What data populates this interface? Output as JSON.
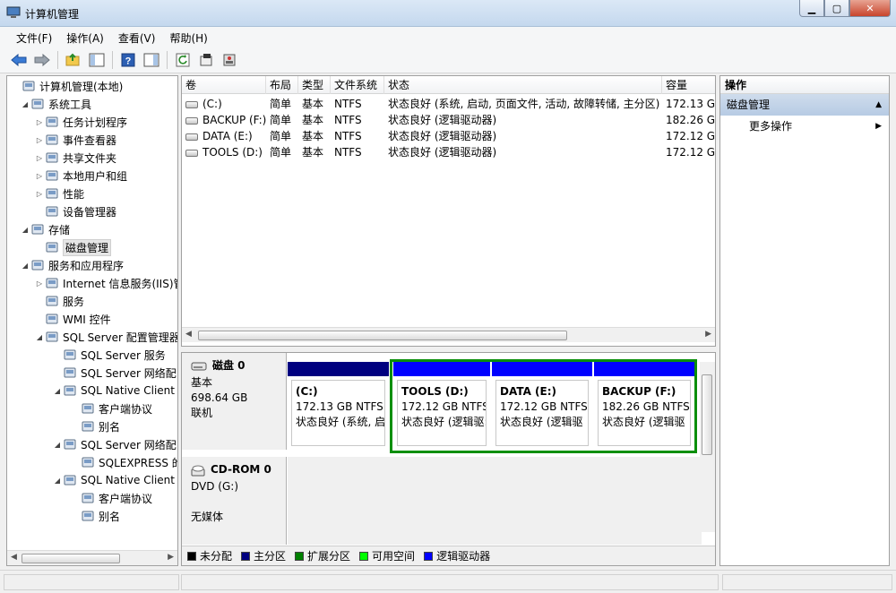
{
  "window": {
    "title": "计算机管理"
  },
  "menu": [
    "文件(F)",
    "操作(A)",
    "查看(V)",
    "帮助(H)"
  ],
  "tree": [
    {
      "label": "计算机管理(本地)",
      "icon": "computer-management-icon",
      "level": 0,
      "exp": ""
    },
    {
      "label": "系统工具",
      "icon": "tools-icon",
      "level": 1,
      "exp": "◢"
    },
    {
      "label": "任务计划程序",
      "icon": "clock-icon",
      "level": 2,
      "exp": "▷"
    },
    {
      "label": "事件查看器",
      "icon": "event-viewer-icon",
      "level": 2,
      "exp": "▷"
    },
    {
      "label": "共享文件夹",
      "icon": "shared-folder-icon",
      "level": 2,
      "exp": "▷"
    },
    {
      "label": "本地用户和组",
      "icon": "users-icon",
      "level": 2,
      "exp": "▷"
    },
    {
      "label": "性能",
      "icon": "performance-icon",
      "level": 2,
      "exp": "▷"
    },
    {
      "label": "设备管理器",
      "icon": "device-manager-icon",
      "level": 2,
      "exp": ""
    },
    {
      "label": "存储",
      "icon": "storage-icon",
      "level": 1,
      "exp": "◢"
    },
    {
      "label": "磁盘管理",
      "icon": "disk-management-icon",
      "level": 2,
      "exp": "",
      "selected": true
    },
    {
      "label": "服务和应用程序",
      "icon": "services-apps-icon",
      "level": 1,
      "exp": "◢"
    },
    {
      "label": "Internet 信息服务(IIS)管",
      "icon": "iis-icon",
      "level": 2,
      "exp": "▷"
    },
    {
      "label": "服务",
      "icon": "services-icon",
      "level": 2,
      "exp": ""
    },
    {
      "label": "WMI 控件",
      "icon": "wmi-icon",
      "level": 2,
      "exp": ""
    },
    {
      "label": "SQL Server 配置管理器",
      "icon": "sql-config-icon",
      "level": 2,
      "exp": "◢"
    },
    {
      "label": "SQL Server 服务",
      "icon": "sql-services-icon",
      "level": 3,
      "exp": ""
    },
    {
      "label": "SQL Server 网络配",
      "icon": "sql-network-icon",
      "level": 3,
      "exp": ""
    },
    {
      "label": "SQL Native Client",
      "icon": "sql-native-client-icon",
      "level": 3,
      "exp": "◢"
    },
    {
      "label": "客户端协议",
      "icon": "protocol-icon",
      "level": 4,
      "exp": ""
    },
    {
      "label": "别名",
      "icon": "alias-icon",
      "level": 4,
      "exp": ""
    },
    {
      "label": "SQL Server 网络配",
      "icon": "sql-network-icon",
      "level": 3,
      "exp": "◢"
    },
    {
      "label": "SQLEXPRESS 的",
      "icon": "protocol-icon",
      "level": 4,
      "exp": ""
    },
    {
      "label": "SQL Native Client",
      "icon": "sql-native-client-icon",
      "level": 3,
      "exp": "◢"
    },
    {
      "label": "客户端协议",
      "icon": "protocol-icon",
      "level": 4,
      "exp": ""
    },
    {
      "label": "别名",
      "icon": "alias-icon",
      "level": 4,
      "exp": ""
    }
  ],
  "volume_list": {
    "columns": [
      "卷",
      "布局",
      "类型",
      "文件系统",
      "状态",
      "容量"
    ],
    "rows": [
      [
        "(C:)",
        "简单",
        "基本",
        "NTFS",
        "状态良好 (系统, 启动, 页面文件, 活动, 故障转储, 主分区)",
        "172.13 G"
      ],
      [
        "BACKUP (F:)",
        "简单",
        "基本",
        "NTFS",
        "状态良好 (逻辑驱动器)",
        "182.26 G"
      ],
      [
        "DATA (E:)",
        "简单",
        "基本",
        "NTFS",
        "状态良好 (逻辑驱动器)",
        "172.12 G"
      ],
      [
        "TOOLS (D:)",
        "简单",
        "基本",
        "NTFS",
        "状态良好 (逻辑驱动器)",
        "172.12 G"
      ]
    ]
  },
  "disks": [
    {
      "name": "磁盘 0",
      "type": "基本",
      "size": "698.64 GB",
      "status": "联机",
      "partitions": [
        {
          "name": "(C:)",
          "size": "172.13 GB NTFS",
          "status": "状态良好 (系统, 启",
          "color": "#000080"
        },
        {
          "name": "TOOLS  (D:)",
          "size": "172.12 GB NTFS",
          "status": "状态良好 (逻辑驱:",
          "color": "#0000ff"
        },
        {
          "name": "DATA  (E:)",
          "size": "172.12 GB NTFS",
          "status": "状态良好 (逻辑驱",
          "color": "#0000ff"
        },
        {
          "name": "BACKUP  (F:)",
          "size": "182.26 GB NTFS",
          "status": "状态良好 (逻辑驱",
          "color": "#0000ff"
        }
      ]
    },
    {
      "name": "CD-ROM 0",
      "type": "DVD (G:)",
      "size": "",
      "status": "无媒体"
    }
  ],
  "legend": [
    {
      "label": "未分配",
      "color": "#000000"
    },
    {
      "label": "主分区",
      "color": "#000080"
    },
    {
      "label": "扩展分区",
      "color": "#008000"
    },
    {
      "label": "可用空间",
      "color": "#00ff00"
    },
    {
      "label": "逻辑驱动器",
      "color": "#0000ff"
    }
  ],
  "actions": {
    "header": "操作",
    "section": "磁盘管理",
    "items": [
      "更多操作"
    ]
  }
}
